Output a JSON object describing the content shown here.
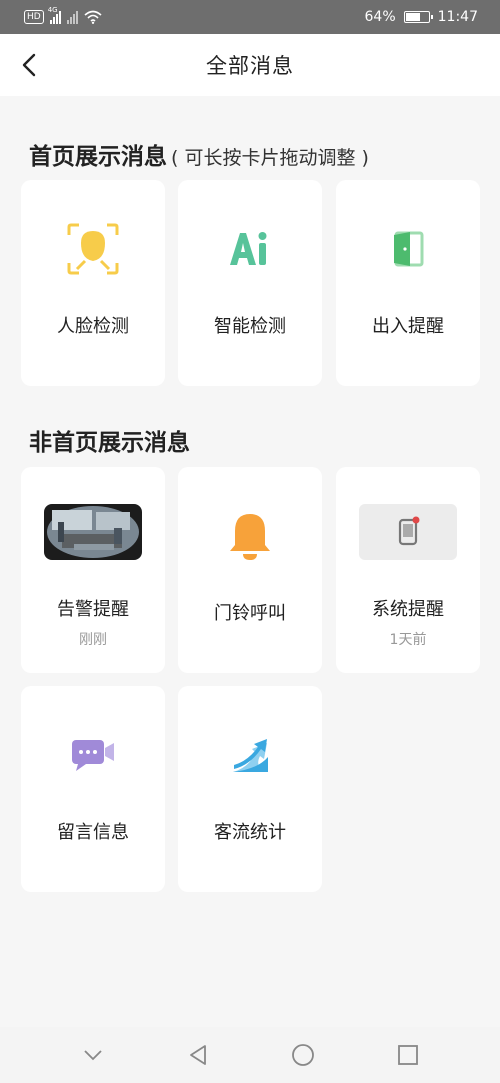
{
  "status_bar": {
    "hd_badge": "HD",
    "network_tag": "4G",
    "battery_percent": "64%",
    "battery_level": 0.64,
    "time": "11:47"
  },
  "header": {
    "back_icon": "chevron-left-icon",
    "title": "全部消息"
  },
  "home_section": {
    "title": "首页展示消息",
    "hint": "( 可长按卡片拖动调整 )",
    "cards": [
      {
        "label": "人脸检测",
        "icon": "face-detection-icon"
      },
      {
        "label": "智能检测",
        "icon": "ai-icon"
      },
      {
        "label": "出入提醒",
        "icon": "door-icon"
      }
    ]
  },
  "other_section": {
    "title": "非首页展示消息",
    "cards": [
      {
        "label": "告警提醒",
        "sub": "刚刚",
        "icon": "camera-snapshot-thumbnail"
      },
      {
        "label": "门铃呼叫",
        "icon": "bell-icon"
      },
      {
        "label": "系统提醒",
        "sub": "1天前",
        "icon": "phone-notification-icon"
      },
      {
        "label": "留言信息",
        "icon": "video-message-icon"
      },
      {
        "label": "客流统计",
        "icon": "trend-up-icon"
      }
    ]
  },
  "nav_bar": {
    "items": [
      "chevron-down-icon",
      "back-triangle-icon",
      "home-circle-icon",
      "recent-square-icon"
    ]
  },
  "colors": {
    "face_yellow": "#f7cc4a",
    "ai_green": "#57c39a",
    "door_green": "#4dbb6e",
    "bell_orange": "#f7a23a",
    "message_purple": "#a08ad8",
    "trend_blue": "#3aa8e0"
  }
}
